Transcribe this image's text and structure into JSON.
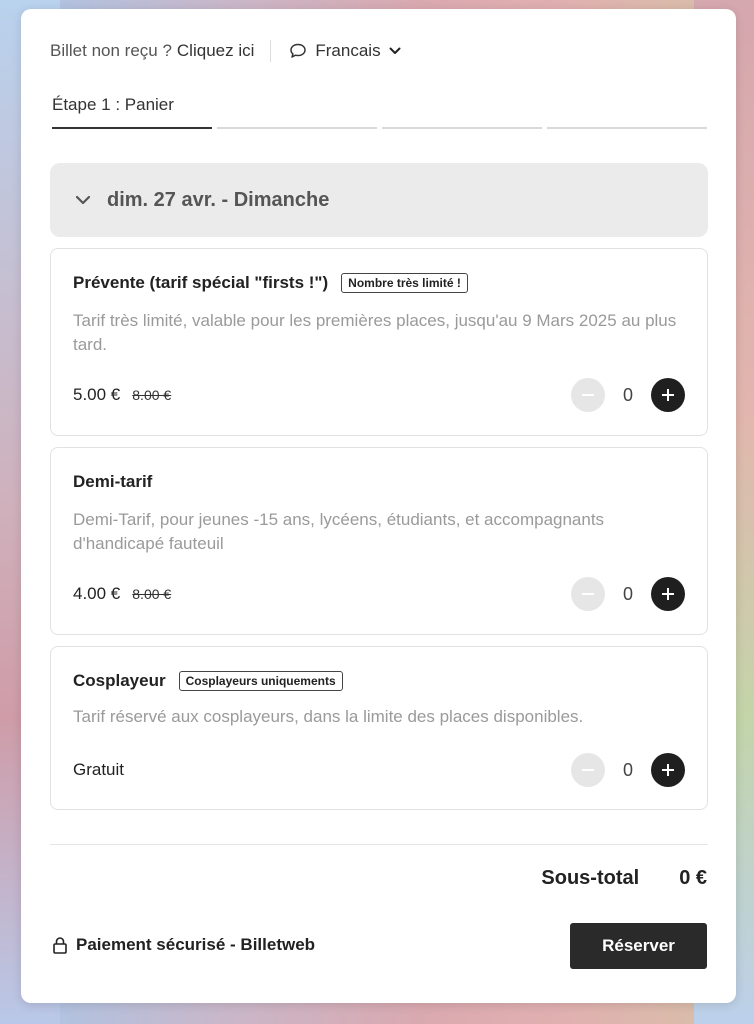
{
  "topbar": {
    "not_received": "Billet non reçu ?",
    "click_here": "Cliquez ici",
    "language": "Francais"
  },
  "steps": {
    "current_label": "Étape 1 : Panier",
    "count": 4
  },
  "date_header": {
    "label": "dim. 27 avr. - Dimanche",
    "icon": "chevron-down-icon"
  },
  "tickets": [
    {
      "name": "Prévente (tarif spécial \"firsts !\")",
      "badge": "Nombre très limité !",
      "description": "Tarif très limité, valable pour les premières places, jusqu'au 9 Mars 2025 au plus tard.",
      "price": "5.00 €",
      "old_price": "8.00 €",
      "quantity": "0"
    },
    {
      "name": "Demi-tarif",
      "badge": "",
      "description": "Demi-Tarif, pour jeunes -15 ans, lycéens, étudiants, et accompagnants d'handicapé fauteuil",
      "price": "4.00 €",
      "old_price": "8.00 €",
      "quantity": "0"
    },
    {
      "name": "Cosplayeur",
      "badge": "Cosplayeurs uniquements",
      "description": "Tarif réservé aux cosplayeurs, dans la limite des places disponibles.",
      "price": "Gratuit",
      "old_price": "",
      "quantity": "0"
    }
  ],
  "footer": {
    "subtotal_label": "Sous-total",
    "subtotal_value": "0 €",
    "secure_label": "Paiement sécurisé - Billetweb",
    "reserve_label": "Réserver"
  },
  "colors": {
    "primary_button": "#2a2a2a",
    "muted_text": "#9a9a9a",
    "date_header_bg": "#ebebeb"
  }
}
